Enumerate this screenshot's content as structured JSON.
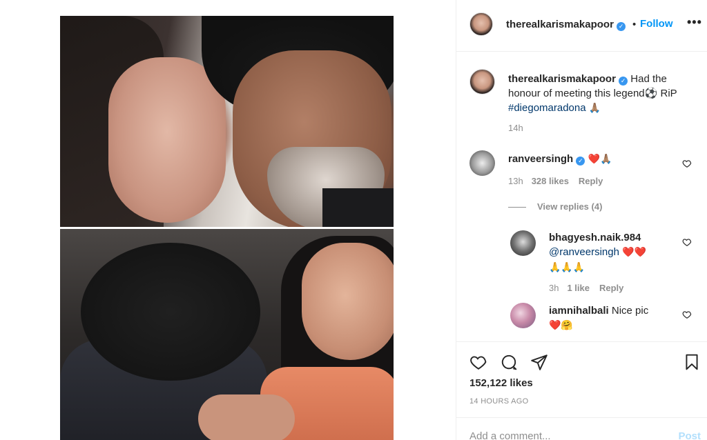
{
  "post": {
    "username": "therealkarismakapoor",
    "follow_label": "Follow",
    "separator": "•",
    "more_label": "•••",
    "verified_mark": "✓",
    "caption_text": "Had the honour of meeting this legend⚽ RiP ",
    "caption_hashtag": "#diegomaradona",
    "caption_emoji": "🙏🏽",
    "caption_time": "14h",
    "likes": "152,122 likes",
    "time_ago": "14 HOURS AGO"
  },
  "comments": [
    {
      "username": "ranveersingh",
      "text": "❤️🙏🏽",
      "time": "13h",
      "likes": "328 likes",
      "reply_label": "Reply",
      "view_replies": "View replies (4)"
    },
    {
      "username": "bhagyesh.naik.984",
      "mention": "@ranveersingh",
      "text": " ❤️❤️",
      "text2": "🙏🙏🙏",
      "time": "3h",
      "likes": "1 like",
      "reply_label": "Reply"
    },
    {
      "username": "iamnihalbali",
      "text": "Nice pic",
      "text2": "❤️🤗"
    }
  ],
  "composer": {
    "placeholder": "Add a comment...",
    "post_label": "Post"
  },
  "icons": [
    "heart-icon",
    "comment-icon",
    "share-icon",
    "bookmark-icon",
    "more-icon",
    "verified-icon"
  ],
  "colors": {
    "link": "#0095f6",
    "hashtag": "#00376b",
    "muted": "#8e8e8e",
    "post_disabled": "#b2dffc"
  }
}
